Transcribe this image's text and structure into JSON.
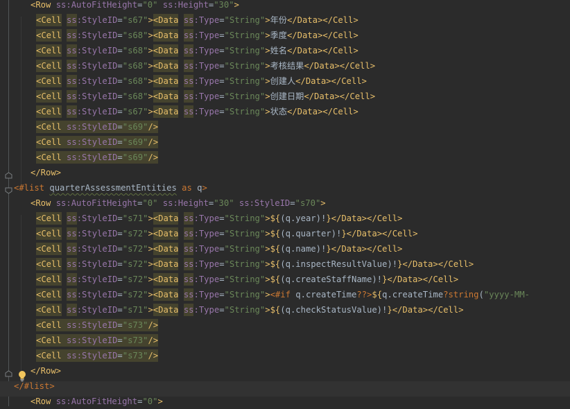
{
  "editor": {
    "lines": [
      {
        "indent": 44,
        "tokens": [
          [
            "tag",
            "<Row "
          ],
          [
            "attr",
            "ss:AutoFitHeight"
          ],
          [
            "txt",
            "="
          ],
          [
            "str",
            "\"0\""
          ],
          [
            "txt",
            " "
          ],
          [
            "attr",
            "ss:Height"
          ],
          [
            "txt",
            "="
          ],
          [
            "str",
            "\"30\""
          ],
          [
            "tag",
            ">"
          ]
        ]
      },
      {
        "indent": 52,
        "tokens": [
          [
            "tag",
            "<Cell "
          ],
          [
            "attr",
            "ss:StyleID"
          ],
          [
            "txt",
            "="
          ],
          [
            "str",
            "\"s67\""
          ],
          [
            "tag",
            ">"
          ],
          [
            "tag",
            "<Data "
          ],
          [
            "attr",
            "ss:Type"
          ],
          [
            "txt",
            "="
          ],
          [
            "str",
            "\"String\""
          ],
          [
            "tag",
            ">"
          ],
          [
            "txt",
            "年份"
          ],
          [
            "tag",
            "</Data>"
          ],
          [
            "tag",
            "</Cell>"
          ]
        ]
      },
      {
        "indent": 52,
        "tokens": [
          [
            "tag",
            "<Cell "
          ],
          [
            "attr",
            "ss:StyleID"
          ],
          [
            "txt",
            "="
          ],
          [
            "str",
            "\"s68\""
          ],
          [
            "tag",
            ">"
          ],
          [
            "tag",
            "<Data "
          ],
          [
            "attr",
            "ss:Type"
          ],
          [
            "txt",
            "="
          ],
          [
            "str",
            "\"String\""
          ],
          [
            "tag",
            ">"
          ],
          [
            "txt",
            "季度"
          ],
          [
            "tag",
            "</Data>"
          ],
          [
            "tag",
            "</Cell>"
          ]
        ]
      },
      {
        "indent": 52,
        "tokens": [
          [
            "tag",
            "<Cell "
          ],
          [
            "attr",
            "ss:StyleID"
          ],
          [
            "txt",
            "="
          ],
          [
            "str",
            "\"s68\""
          ],
          [
            "tag",
            ">"
          ],
          [
            "tag",
            "<Data "
          ],
          [
            "attr",
            "ss:Type"
          ],
          [
            "txt",
            "="
          ],
          [
            "str",
            "\"String\""
          ],
          [
            "tag",
            ">"
          ],
          [
            "txt",
            "姓名"
          ],
          [
            "tag",
            "</Data>"
          ],
          [
            "tag",
            "</Cell>"
          ]
        ]
      },
      {
        "indent": 52,
        "tokens": [
          [
            "tag",
            "<Cell "
          ],
          [
            "attr",
            "ss:StyleID"
          ],
          [
            "txt",
            "="
          ],
          [
            "str",
            "\"s68\""
          ],
          [
            "tag",
            ">"
          ],
          [
            "tag",
            "<Data "
          ],
          [
            "attr",
            "ss:Type"
          ],
          [
            "txt",
            "="
          ],
          [
            "str",
            "\"String\""
          ],
          [
            "tag",
            ">"
          ],
          [
            "txt",
            "考核结果"
          ],
          [
            "tag",
            "</Data>"
          ],
          [
            "tag",
            "</Cell>"
          ]
        ]
      },
      {
        "indent": 52,
        "tokens": [
          [
            "tag",
            "<Cell "
          ],
          [
            "attr",
            "ss:StyleID"
          ],
          [
            "txt",
            "="
          ],
          [
            "str",
            "\"s68\""
          ],
          [
            "tag",
            ">"
          ],
          [
            "tag",
            "<Data "
          ],
          [
            "attr",
            "ss:Type"
          ],
          [
            "txt",
            "="
          ],
          [
            "str",
            "\"String\""
          ],
          [
            "tag",
            ">"
          ],
          [
            "txt",
            "创建人"
          ],
          [
            "tag",
            "</Data>"
          ],
          [
            "tag",
            "</Cell>"
          ]
        ]
      },
      {
        "indent": 52,
        "tokens": [
          [
            "tag",
            "<Cell "
          ],
          [
            "attr",
            "ss:StyleID"
          ],
          [
            "txt",
            "="
          ],
          [
            "str",
            "\"s68\""
          ],
          [
            "tag",
            ">"
          ],
          [
            "tag",
            "<Data "
          ],
          [
            "attr",
            "ss:Type"
          ],
          [
            "txt",
            "="
          ],
          [
            "str",
            "\"String\""
          ],
          [
            "tag",
            ">"
          ],
          [
            "txt",
            "创建日期"
          ],
          [
            "tag",
            "</Data>"
          ],
          [
            "tag",
            "</Cell>"
          ]
        ]
      },
      {
        "indent": 52,
        "tokens": [
          [
            "tag",
            "<Cell "
          ],
          [
            "attr",
            "ss:StyleID"
          ],
          [
            "txt",
            "="
          ],
          [
            "str",
            "\"s67\""
          ],
          [
            "tag",
            ">"
          ],
          [
            "tag",
            "<Data "
          ],
          [
            "attr",
            "ss:Type"
          ],
          [
            "txt",
            "="
          ],
          [
            "str",
            "\"String\""
          ],
          [
            "tag",
            ">"
          ],
          [
            "txt",
            "状态"
          ],
          [
            "tag",
            "</Data>"
          ],
          [
            "tag",
            "</Cell>"
          ]
        ]
      },
      {
        "indent": 52,
        "tokens": [
          [
            "tag",
            "<Cell "
          ],
          [
            "attr",
            "ss:StyleID"
          ],
          [
            "txt",
            "="
          ],
          [
            "str",
            "\"s69\""
          ],
          [
            "tag",
            "/>"
          ]
        ]
      },
      {
        "indent": 52,
        "tokens": [
          [
            "tag",
            "<Cell "
          ],
          [
            "attr",
            "ss:StyleID"
          ],
          [
            "txt",
            "="
          ],
          [
            "str",
            "\"s69\""
          ],
          [
            "tag",
            "/>"
          ]
        ]
      },
      {
        "indent": 52,
        "tokens": [
          [
            "tag",
            "<Cell "
          ],
          [
            "attr",
            "ss:StyleID"
          ],
          [
            "txt",
            "="
          ],
          [
            "str",
            "\"s69\""
          ],
          [
            "tag",
            "/>"
          ]
        ]
      },
      {
        "indent": 44,
        "tokens": [
          [
            "tag",
            "</Row>"
          ]
        ]
      },
      {
        "indent": 20,
        "tokens": [
          [
            "ftl",
            "<#list "
          ],
          [
            "ident",
            "quarterAssessmentEntities"
          ],
          [
            "txt",
            " "
          ],
          [
            "ftl",
            "as"
          ],
          [
            "txt",
            " q"
          ],
          [
            "ftl",
            ">"
          ]
        ]
      },
      {
        "indent": 44,
        "tokens": [
          [
            "tag",
            "<Row "
          ],
          [
            "attr",
            "ss:AutoFitHeight"
          ],
          [
            "txt",
            "="
          ],
          [
            "str",
            "\"0\""
          ],
          [
            "txt",
            " "
          ],
          [
            "attr",
            "ss:Height"
          ],
          [
            "txt",
            "="
          ],
          [
            "str",
            "\"30\""
          ],
          [
            "txt",
            " "
          ],
          [
            "attr",
            "ss:StyleID"
          ],
          [
            "txt",
            "="
          ],
          [
            "str",
            "\"s70\""
          ],
          [
            "tag",
            ">"
          ]
        ]
      },
      {
        "indent": 52,
        "tokens": [
          [
            "tag",
            "<Cell "
          ],
          [
            "attr",
            "ss:StyleID"
          ],
          [
            "txt",
            "="
          ],
          [
            "str",
            "\"s71\""
          ],
          [
            "tag",
            ">"
          ],
          [
            "tag",
            "<Data "
          ],
          [
            "attr",
            "ss:Type"
          ],
          [
            "txt",
            "="
          ],
          [
            "str",
            "\"String\""
          ],
          [
            "tag",
            ">"
          ],
          [
            "dollar",
            "${"
          ],
          [
            "txt",
            "(q.year)!"
          ],
          [
            "dollar",
            "}"
          ],
          [
            "tag",
            "</Data>"
          ],
          [
            "tag",
            "</Cell>"
          ]
        ]
      },
      {
        "indent": 52,
        "tokens": [
          [
            "tag",
            "<Cell "
          ],
          [
            "attr",
            "ss:StyleID"
          ],
          [
            "txt",
            "="
          ],
          [
            "str",
            "\"s72\""
          ],
          [
            "tag",
            ">"
          ],
          [
            "tag",
            "<Data "
          ],
          [
            "attr",
            "ss:Type"
          ],
          [
            "txt",
            "="
          ],
          [
            "str",
            "\"String\""
          ],
          [
            "tag",
            ">"
          ],
          [
            "dollar",
            "${"
          ],
          [
            "txt",
            "(q.quarter)!"
          ],
          [
            "dollar",
            "}"
          ],
          [
            "tag",
            "</Data>"
          ],
          [
            "tag",
            "</Cell>"
          ]
        ]
      },
      {
        "indent": 52,
        "tokens": [
          [
            "tag",
            "<Cell "
          ],
          [
            "attr",
            "ss:StyleID"
          ],
          [
            "txt",
            "="
          ],
          [
            "str",
            "\"s72\""
          ],
          [
            "tag",
            ">"
          ],
          [
            "tag",
            "<Data "
          ],
          [
            "attr",
            "ss:Type"
          ],
          [
            "txt",
            "="
          ],
          [
            "str",
            "\"String\""
          ],
          [
            "tag",
            ">"
          ],
          [
            "dollar",
            "${"
          ],
          [
            "txt",
            "(q.name)!"
          ],
          [
            "dollar",
            "}"
          ],
          [
            "tag",
            "</Data>"
          ],
          [
            "tag",
            "</Cell>"
          ]
        ]
      },
      {
        "indent": 52,
        "tokens": [
          [
            "tag",
            "<Cell "
          ],
          [
            "attr",
            "ss:StyleID"
          ],
          [
            "txt",
            "="
          ],
          [
            "str",
            "\"s72\""
          ],
          [
            "tag",
            ">"
          ],
          [
            "tag",
            "<Data "
          ],
          [
            "attr",
            "ss:Type"
          ],
          [
            "txt",
            "="
          ],
          [
            "str",
            "\"String\""
          ],
          [
            "tag",
            ">"
          ],
          [
            "dollar",
            "${"
          ],
          [
            "txt",
            "(q.inspectResultValue)!"
          ],
          [
            "dollar",
            "}"
          ],
          [
            "tag",
            "</Data>"
          ],
          [
            "tag",
            "</Cell>"
          ]
        ]
      },
      {
        "indent": 52,
        "tokens": [
          [
            "tag",
            "<Cell "
          ],
          [
            "attr",
            "ss:StyleID"
          ],
          [
            "txt",
            "="
          ],
          [
            "str",
            "\"s72\""
          ],
          [
            "tag",
            ">"
          ],
          [
            "tag",
            "<Data "
          ],
          [
            "attr",
            "ss:Type"
          ],
          [
            "txt",
            "="
          ],
          [
            "str",
            "\"String\""
          ],
          [
            "tag",
            ">"
          ],
          [
            "dollar",
            "${"
          ],
          [
            "txt",
            "(q.createStaffName)!"
          ],
          [
            "dollar",
            "}"
          ],
          [
            "tag",
            "</Data>"
          ],
          [
            "tag",
            "</Cell>"
          ]
        ]
      },
      {
        "indent": 52,
        "tokens": [
          [
            "tag",
            "<Cell "
          ],
          [
            "attr",
            "ss:StyleID"
          ],
          [
            "txt",
            "="
          ],
          [
            "str",
            "\"s72\""
          ],
          [
            "tag",
            ">"
          ],
          [
            "tag",
            "<Data "
          ],
          [
            "attr",
            "ss:Type"
          ],
          [
            "txt",
            "="
          ],
          [
            "str",
            "\"String\""
          ],
          [
            "tag",
            ">"
          ],
          [
            "ftl",
            "<#if "
          ],
          [
            "txt",
            "q.createTime"
          ],
          [
            "ftl",
            "??"
          ],
          [
            "ftl",
            ">"
          ],
          [
            "dollar",
            "${"
          ],
          [
            "txt",
            "q.createTime"
          ],
          [
            "ftl",
            "?string"
          ],
          [
            "txt",
            "("
          ],
          [
            "str",
            "\"yyyy-MM-"
          ]
        ]
      },
      {
        "indent": 52,
        "tokens": [
          [
            "tag",
            "<Cell "
          ],
          [
            "attr",
            "ss:StyleID"
          ],
          [
            "txt",
            "="
          ],
          [
            "str",
            "\"s71\""
          ],
          [
            "tag",
            ">"
          ],
          [
            "tag",
            "<Data "
          ],
          [
            "attr",
            "ss:Type"
          ],
          [
            "txt",
            "="
          ],
          [
            "str",
            "\"String\""
          ],
          [
            "tag",
            ">"
          ],
          [
            "dollar",
            "${"
          ],
          [
            "txt",
            "(q.checkStatusValue)!"
          ],
          [
            "dollar",
            "}"
          ],
          [
            "tag",
            "</Data>"
          ],
          [
            "tag",
            "</Cell>"
          ]
        ]
      },
      {
        "indent": 52,
        "tokens": [
          [
            "tag",
            "<Cell "
          ],
          [
            "attr",
            "ss:StyleID"
          ],
          [
            "txt",
            "="
          ],
          [
            "str",
            "\"s73\""
          ],
          [
            "tag",
            "/>"
          ]
        ]
      },
      {
        "indent": 52,
        "tokens": [
          [
            "tag",
            "<Cell "
          ],
          [
            "attr",
            "ss:StyleID"
          ],
          [
            "txt",
            "="
          ],
          [
            "str",
            "\"s73\""
          ],
          [
            "tag",
            "/>"
          ]
        ]
      },
      {
        "indent": 52,
        "tokens": [
          [
            "tag",
            "<Cell "
          ],
          [
            "attr",
            "ss:StyleID"
          ],
          [
            "txt",
            "="
          ],
          [
            "str",
            "\"s73\""
          ],
          [
            "tag",
            "/>"
          ]
        ]
      },
      {
        "indent": 44,
        "tokens": [
          [
            "tag",
            "</Row>"
          ]
        ]
      },
      {
        "indent": 20,
        "tokens": [
          [
            "ftl",
            "</#list>"
          ]
        ]
      },
      {
        "indent": 44,
        "tokens": [
          [
            "tag",
            "<Row "
          ],
          [
            "attr",
            "ss:AutoFitHeight"
          ],
          [
            "txt",
            "="
          ],
          [
            "str",
            "\"0\""
          ],
          [
            "tag",
            ">"
          ]
        ]
      }
    ]
  },
  "icons": {
    "bulb": "lightbulb-icon",
    "fold": "fold-marker-icon"
  },
  "colors": {
    "background": "#2b2b2b",
    "tag": "#e8bf6a",
    "attribute": "#9876aa",
    "string": "#6a8759",
    "text": "#a9b7c6",
    "keyword": "#cc7832",
    "highlight": "#4b4936",
    "current_line": "#323232"
  }
}
